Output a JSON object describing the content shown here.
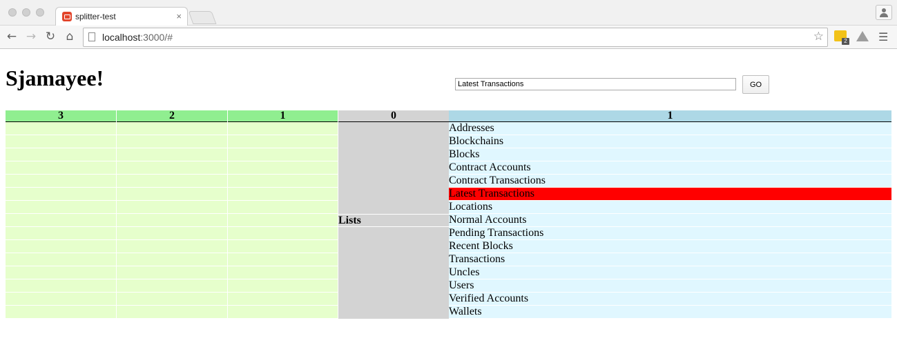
{
  "browser": {
    "tab_title": "splitter-test",
    "tab_close": "×",
    "url_host": "localhost",
    "url_rest": ":3000/#",
    "ext_badge": "2"
  },
  "page": {
    "heading": "Sjamayee!",
    "search_value": "Latest Transactions",
    "go_label": "GO"
  },
  "panes": [
    {
      "header": "3",
      "style": "green"
    },
    {
      "header": "2",
      "style": "green"
    },
    {
      "header": "1",
      "style": "green"
    },
    {
      "header": "0",
      "style": "grey",
      "selected_label": "Lists"
    },
    {
      "header": "1",
      "style": "blue"
    }
  ],
  "list_items": [
    "Addresses",
    "Blockchains",
    "Blocks",
    "Contract Accounts",
    "Contract Transactions",
    "Latest Transactions",
    "Locations",
    "Normal Accounts",
    "Pending Transactions",
    "Recent Blocks",
    "Transactions",
    "Uncles",
    "Users",
    "Verified Accounts",
    "Wallets"
  ],
  "active_item": "Latest Transactions",
  "colors": {
    "green_header": "#90ee90",
    "green_cell": "#e6ffcc",
    "grey": "#d3d3d3",
    "blue_header": "#add8e6",
    "blue_cell": "#e0f7ff",
    "active": "#ff0000"
  }
}
